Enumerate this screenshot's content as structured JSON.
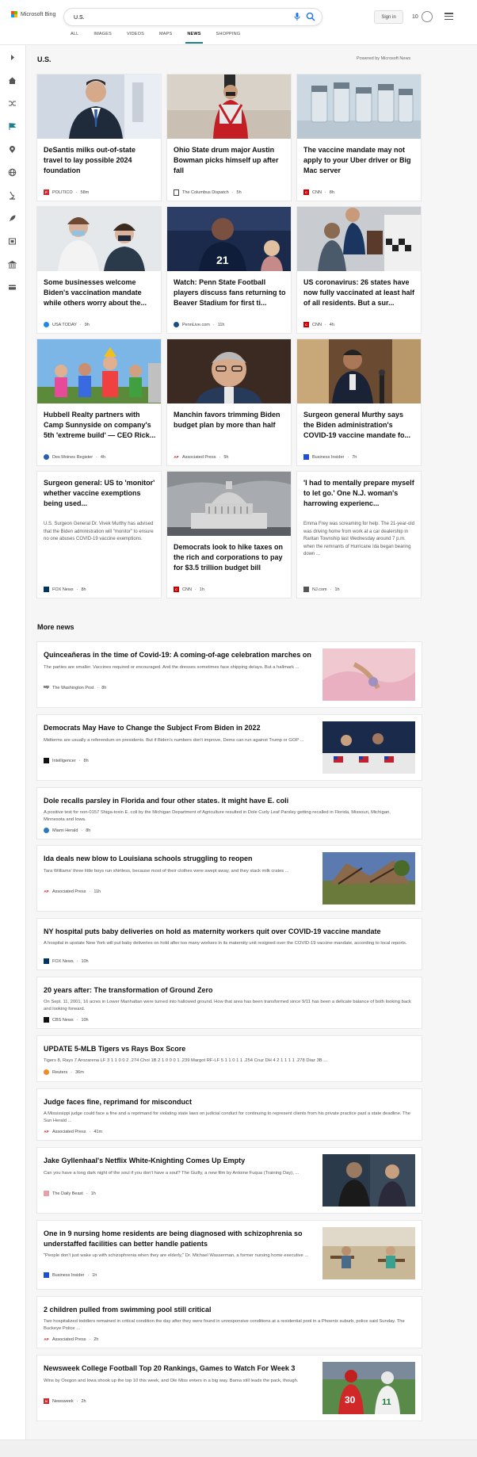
{
  "header": {
    "logo_text": "Microsoft Bing",
    "search_value": "U.S.",
    "sign_in": "Sign in",
    "rewards_count": "10"
  },
  "tabs": [
    {
      "label": "ALL"
    },
    {
      "label": "IMAGES"
    },
    {
      "label": "VIDEOS"
    },
    {
      "label": "MAPS"
    },
    {
      "label": "NEWS",
      "active": true
    },
    {
      "label": "SHOPPING"
    }
  ],
  "sidebar_icons": [
    "expand-arrow-icon",
    "home-icon",
    "shuffle-icon",
    "flag-icon",
    "location-pin-icon",
    "globe-icon",
    "microscope-icon",
    "rocket-icon",
    "film-icon",
    "bank-icon",
    "credit-card-icon"
  ],
  "section": {
    "title": "U.S.",
    "powered_by": "Powered by Microsoft News"
  },
  "cards": [
    {
      "title": "DeSantis milks out-of-state travel to lay possible 2024 foundation",
      "source": "POLITICO",
      "time": "58m",
      "logo_color": "#d0282e"
    },
    {
      "title": "Ohio State drum major Austin Bowman picks himself up after fall",
      "source": "The Columbus Dispatch",
      "time": "5h",
      "logo_color": "#444444"
    },
    {
      "title": "The vaccine mandate may not apply to your Uber driver or Big Mac server",
      "source": "CNN",
      "time": "8h",
      "logo_color": "#cc0000"
    },
    {
      "title": "Some businesses welcome Biden's vaccination mandate while others worry about the...",
      "source": "USA TODAY",
      "time": "9h",
      "logo_color": "#1e88e5"
    },
    {
      "title": "Watch: Penn State Football players discuss fans returning to Beaver Stadium for first ti...",
      "source": "PennLive.com",
      "time": "11h",
      "logo_color": "#1a4d8c"
    },
    {
      "title": "US coronavirus: 26 states have now fully vaccinated at least half of all residents. But a sur...",
      "source": "CNN",
      "time": "4h",
      "logo_color": "#cc0000"
    },
    {
      "title": "Hubbell Realty partners with Camp Sunnyside on company's 5th 'extreme build' — CEO Rick...",
      "source": "Des Moines Register",
      "time": "4h",
      "logo_color": "#2a5db0"
    },
    {
      "title": "Manchin favors trimming Biden budget plan by more than half",
      "source": "Associated Press",
      "time": "5h",
      "logo_color": "#d0282e"
    },
    {
      "title": "Surgeon general Murthy says the Biden administration's COVID-19 vaccine mandate fo...",
      "source": "Business Insider",
      "time": "7h",
      "logo_color": "#1d4ed8"
    }
  ],
  "text_cards": [
    {
      "title": "Surgeon general: US to 'monitor' whether vaccine exemptions being used...",
      "snippet": "U.S. Surgeon General Dr. Vivek Murthy has advised that the Biden administration will \"monitor\" to ensure no one abuses COVID-19 vaccine exemptions.",
      "source": "FOX News",
      "time": "8h",
      "logo_color": "#003366"
    },
    {
      "title": "'I had to mentally prepare myself to let go.' One N.J. woman's harrowing experienc...",
      "snippet": "Emma Frey was screaming for help. The 21-year-old was driving home from work at a car dealership in Raritan Township last Wednesday around 7 p.m. when the remnants of Hurricane Ida began bearing down ...",
      "source": "NJ.com",
      "time": "1h",
      "logo_color": "#555555"
    }
  ],
  "capitol_card": {
    "title": "Democrats look to hike taxes on the rich and corporations to pay for $3.5 trillion budget bill",
    "source": "CNN",
    "time": "1h",
    "logo_color": "#cc0000"
  },
  "more_news": {
    "title": "More news",
    "items": [
      {
        "title": "Quinceañeras in the time of Covid-19: A coming-of-age celebration marches on",
        "snippet": "The parties are smaller. Vaccines required or encouraged. And the dresses sometimes face shipping delays. But a hallmark ...",
        "source": "The Washington Post",
        "time": "8h",
        "logo_color": "#222222"
      },
      {
        "title": "Democrats May Have to Change the Subject From Biden in 2022",
        "snippet": "Midterms are usually a referendum on presidents. But if Biden's numbers don't improve, Dems can run against Trump or GOP ...",
        "source": "Intelligencer",
        "time": "8h",
        "logo_color": "#111111"
      },
      {
        "title": "Dole recalls parsley in Florida and four other states. It might have E. coli",
        "snippet": "A positive test for non-0157 Shiga-toxin E. coli by the Michigan Department of Agriculture resulted in Dole Curly Leaf Parsley getting recalled in Florida, Missouri, Michigan, Minnesota and Iowa.",
        "source": "Miami Herald",
        "time": "8h",
        "logo_color": "#2a7ac0"
      },
      {
        "title": "Ida deals new blow to Louisiana schools struggling to reopen",
        "snippet": "Tara Williams' three little boys run shirtless, because most of their clothes were swept away, and they stack milk crates ...",
        "source": "Associated Press",
        "time": "11h",
        "logo_color": "#d0282e"
      },
      {
        "title": "NY hospital puts baby deliveries on hold as maternity workers quit over COVID-19 vaccine mandate",
        "snippet": "A hospital in upstate New York will put baby deliveries on hold after too many workers in its maternity unit resigned over the COVID-19 vaccine mandate, according to local reports.",
        "source": "FOX News",
        "time": "10h",
        "logo_color": "#003366"
      },
      {
        "title": "20 years after: The transformation of Ground Zero",
        "snippet": "On Sept. 11, 2001, 16 acres in Lower Manhattan were turned into hallowed ground. How that area has been transformed since 9/11 has been a delicate balance of both looking back and looking forward.",
        "source": "CBS News",
        "time": "10h",
        "logo_color": "#111111"
      },
      {
        "title": "UPDATE 5-MLB Tigers vs Rays Box Score",
        "snippet": "Tigers 8, Rays 7 Arozarena LF 3 1 1 0 0 2 .274 Choi 1B 2 1 0 0 0 1 .239 Margot RF-LF 5 1 1 0 1 1 .254 Cruz DH 4 2 1 1 1 1 .278 Diaz 3B ...",
        "source": "Reuters",
        "time": "36m",
        "logo_color": "#f08a24"
      },
      {
        "title": "Judge faces fine, reprimand for misconduct",
        "snippet": "A Mississippi judge could face a fine and a reprimand for violating state laws on judicial conduct for continuing to represent clients from his private practice past a state deadline. The Sun Herald ...",
        "source": "Associated Press",
        "time": "41m",
        "logo_color": "#d0282e"
      },
      {
        "title": "Jake Gyllenhaal's Netflix White-Knighting Comes Up Empty",
        "snippet": "Can you have a long dark night of the soul if you don't have a soul? The Guilty, a new film by Antoine Fuqua (Training Day), ...",
        "source": "The Daily Beast",
        "time": "1h",
        "logo_color": "#e8a0a8"
      },
      {
        "title": "One in 9 nursing home residents are being diagnosed with schizophrenia so understaffed facilities can better handle patients",
        "snippet": "\"People don't just wake up with schizophrenia when they are elderly,\" Dr. Michael Wasserman, a former nursing home executive ...",
        "source": "Business Insider",
        "time": "1h",
        "logo_color": "#1d4ed8"
      },
      {
        "title": "2 children pulled from swimming pool still critical",
        "snippet": "Two hospitalized toddlers remained in critical condition the day after they were found in unresponsive conditions at a residential pool in a Phoenix suburb, police said Sunday. The Buckeye Police ...",
        "source": "Associated Press",
        "time": "2h",
        "logo_color": "#d0282e"
      },
      {
        "title": "Newsweek College Football Top 20 Rankings, Games to Watch For Week 3",
        "snippet": "Wins by Oregon and Iowa shook up the top 10 this week, and Ole Miss enters in a big way. Bama still leads the pack, though.",
        "source": "Newsweek",
        "time": "2h",
        "logo_color": "#d0282e"
      }
    ]
  }
}
